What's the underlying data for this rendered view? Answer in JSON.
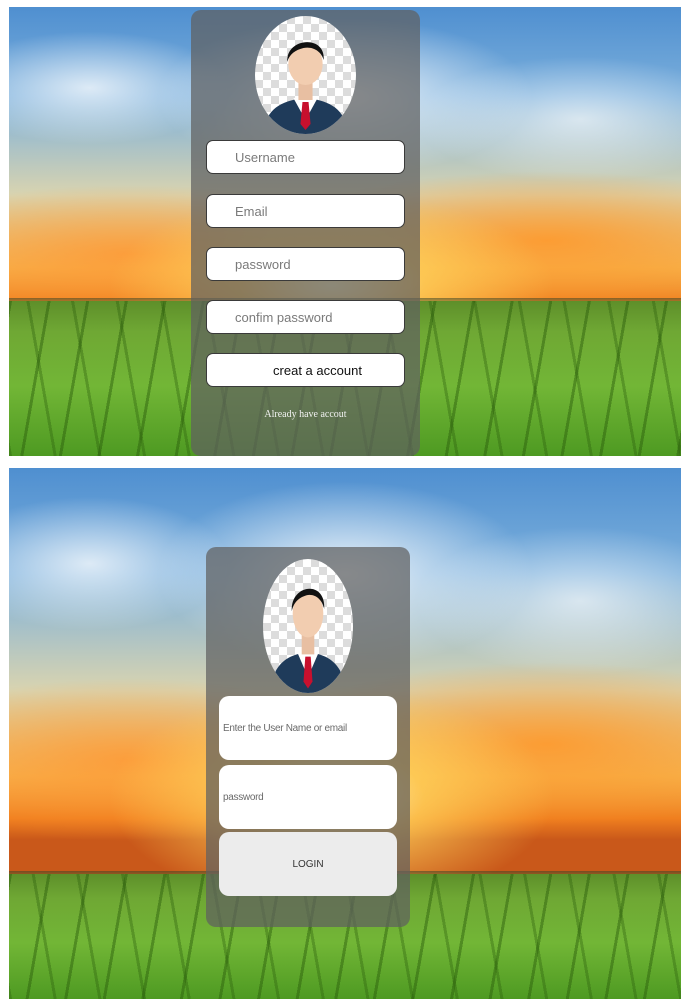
{
  "signup": {
    "username_placeholder": "Username",
    "email_placeholder": "Email",
    "password_placeholder": "password",
    "confirm_placeholder": "confim password",
    "create_button": "creat a account",
    "have_account_link": "Already have accout"
  },
  "login": {
    "user_placeholder": "Enter the User Name or email",
    "password_placeholder": "password",
    "login_button": "LOGIN"
  },
  "icons": {
    "avatar": "user-avatar-icon"
  },
  "colors": {
    "panel": "#5f5f5f",
    "field_bg": "#ffffff",
    "tie": "#c8102e",
    "suit": "#1f3b5a"
  }
}
